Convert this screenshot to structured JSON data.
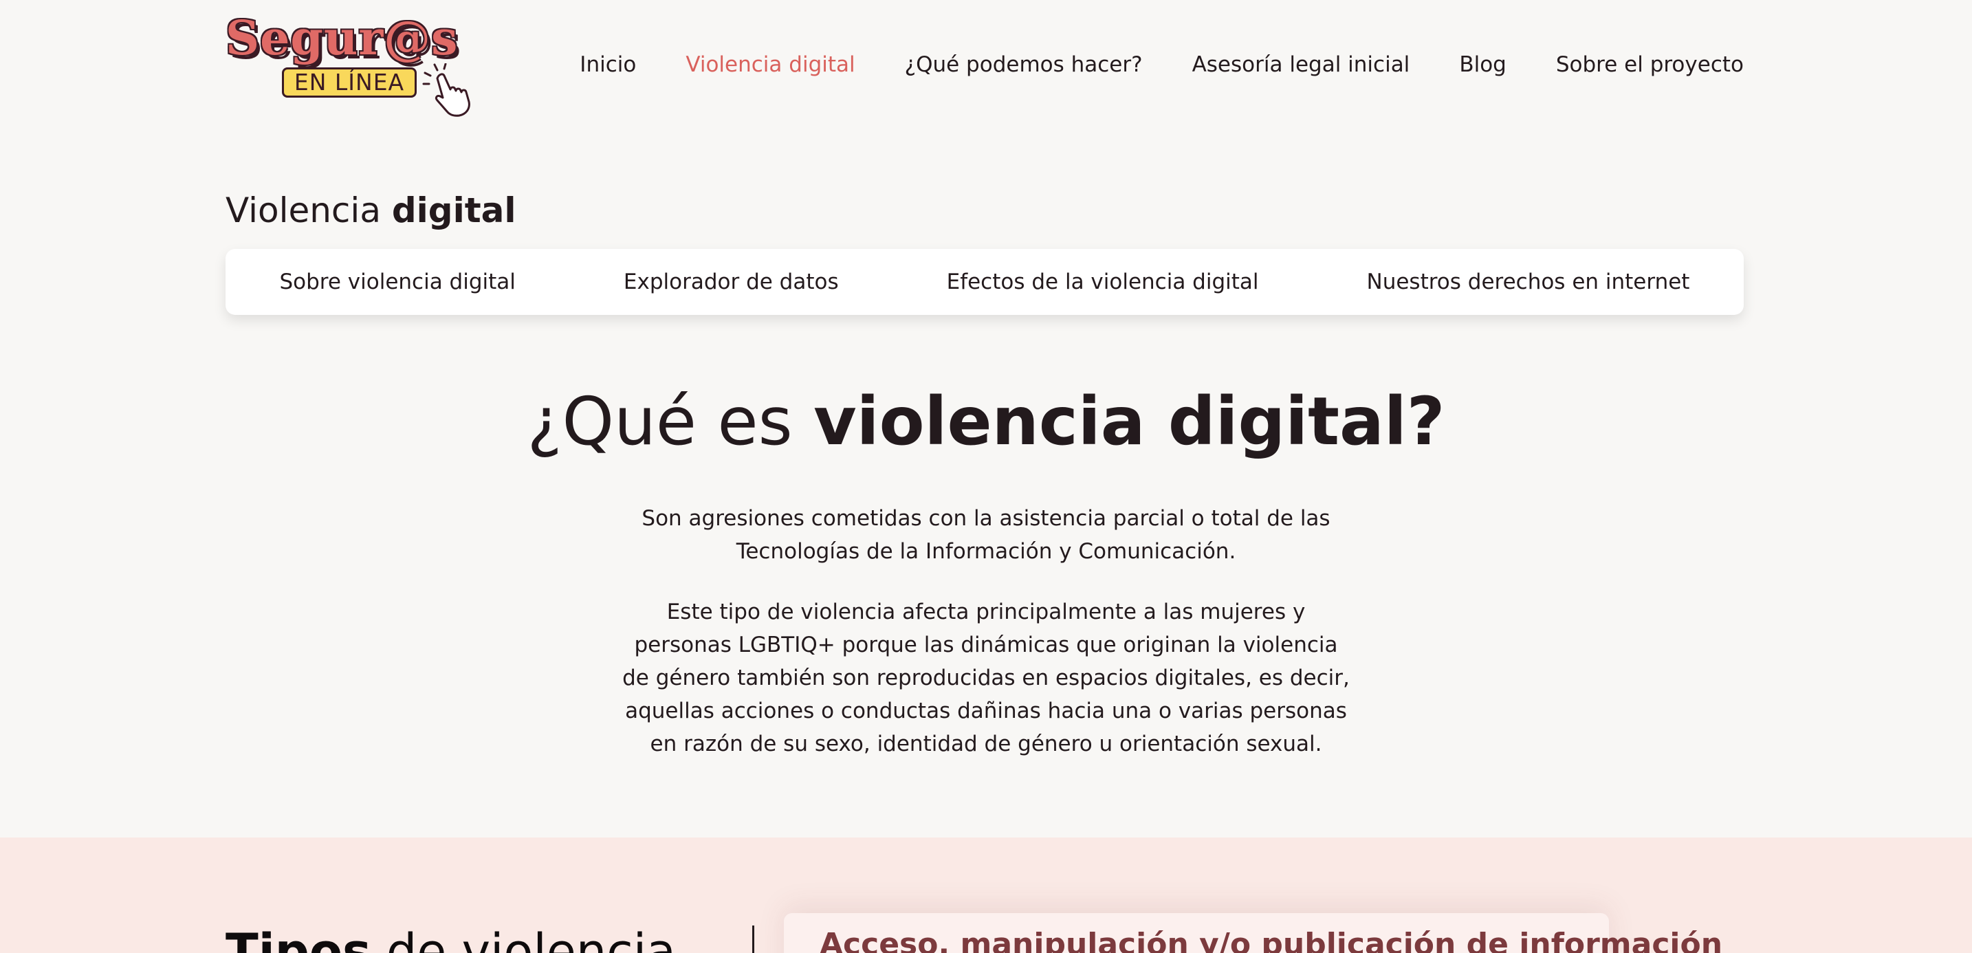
{
  "brand": {
    "logo_word": "Segur@s",
    "logo_badge": "EN LÍNEA",
    "colors": {
      "accent": "#d9615c",
      "logo_red": "#e06a66",
      "badge_yellow": "#f9d85b",
      "dark": "#231a1d",
      "band_pink": "#fae9e5",
      "card_title": "#7c3a3d"
    }
  },
  "nav": {
    "items": [
      {
        "label": "Inicio"
      },
      {
        "label": "Violencia digital"
      },
      {
        "label": "¿Qué podemos hacer?"
      },
      {
        "label": "Asesoría legal inicial"
      },
      {
        "label": "Blog"
      },
      {
        "label": "Sobre el proyecto"
      }
    ]
  },
  "section": {
    "title_light": "Violencia",
    "title_bold": "digital",
    "tabs": [
      {
        "label": "Sobre violencia digital"
      },
      {
        "label": "Explorador de datos"
      },
      {
        "label": "Efectos de la violencia digital"
      },
      {
        "label": "Nuestros derechos en internet"
      }
    ]
  },
  "main": {
    "heading_light": "¿Qué es",
    "heading_bold": "violencia digital?",
    "paragraph_1": "Son agresiones cometidas con la asistencia parcial o total de las Tecnologías de la Información y Comunicación.",
    "paragraph_2": "Este tipo de violencia afecta principalmente a las mujeres y personas LGBTIQ+ porque las dinámicas que originan la violencia de género también son reproducidas en espacios digitales, es decir, aquellas acciones o conductas dañinas hacia una o varias personas en razón de su sexo, identidad de género u orientación sexual."
  },
  "types": {
    "title_bold": "Tipos",
    "title_light": "de violencia",
    "card_title": "Acceso, manipulación y/o publicación de información"
  }
}
